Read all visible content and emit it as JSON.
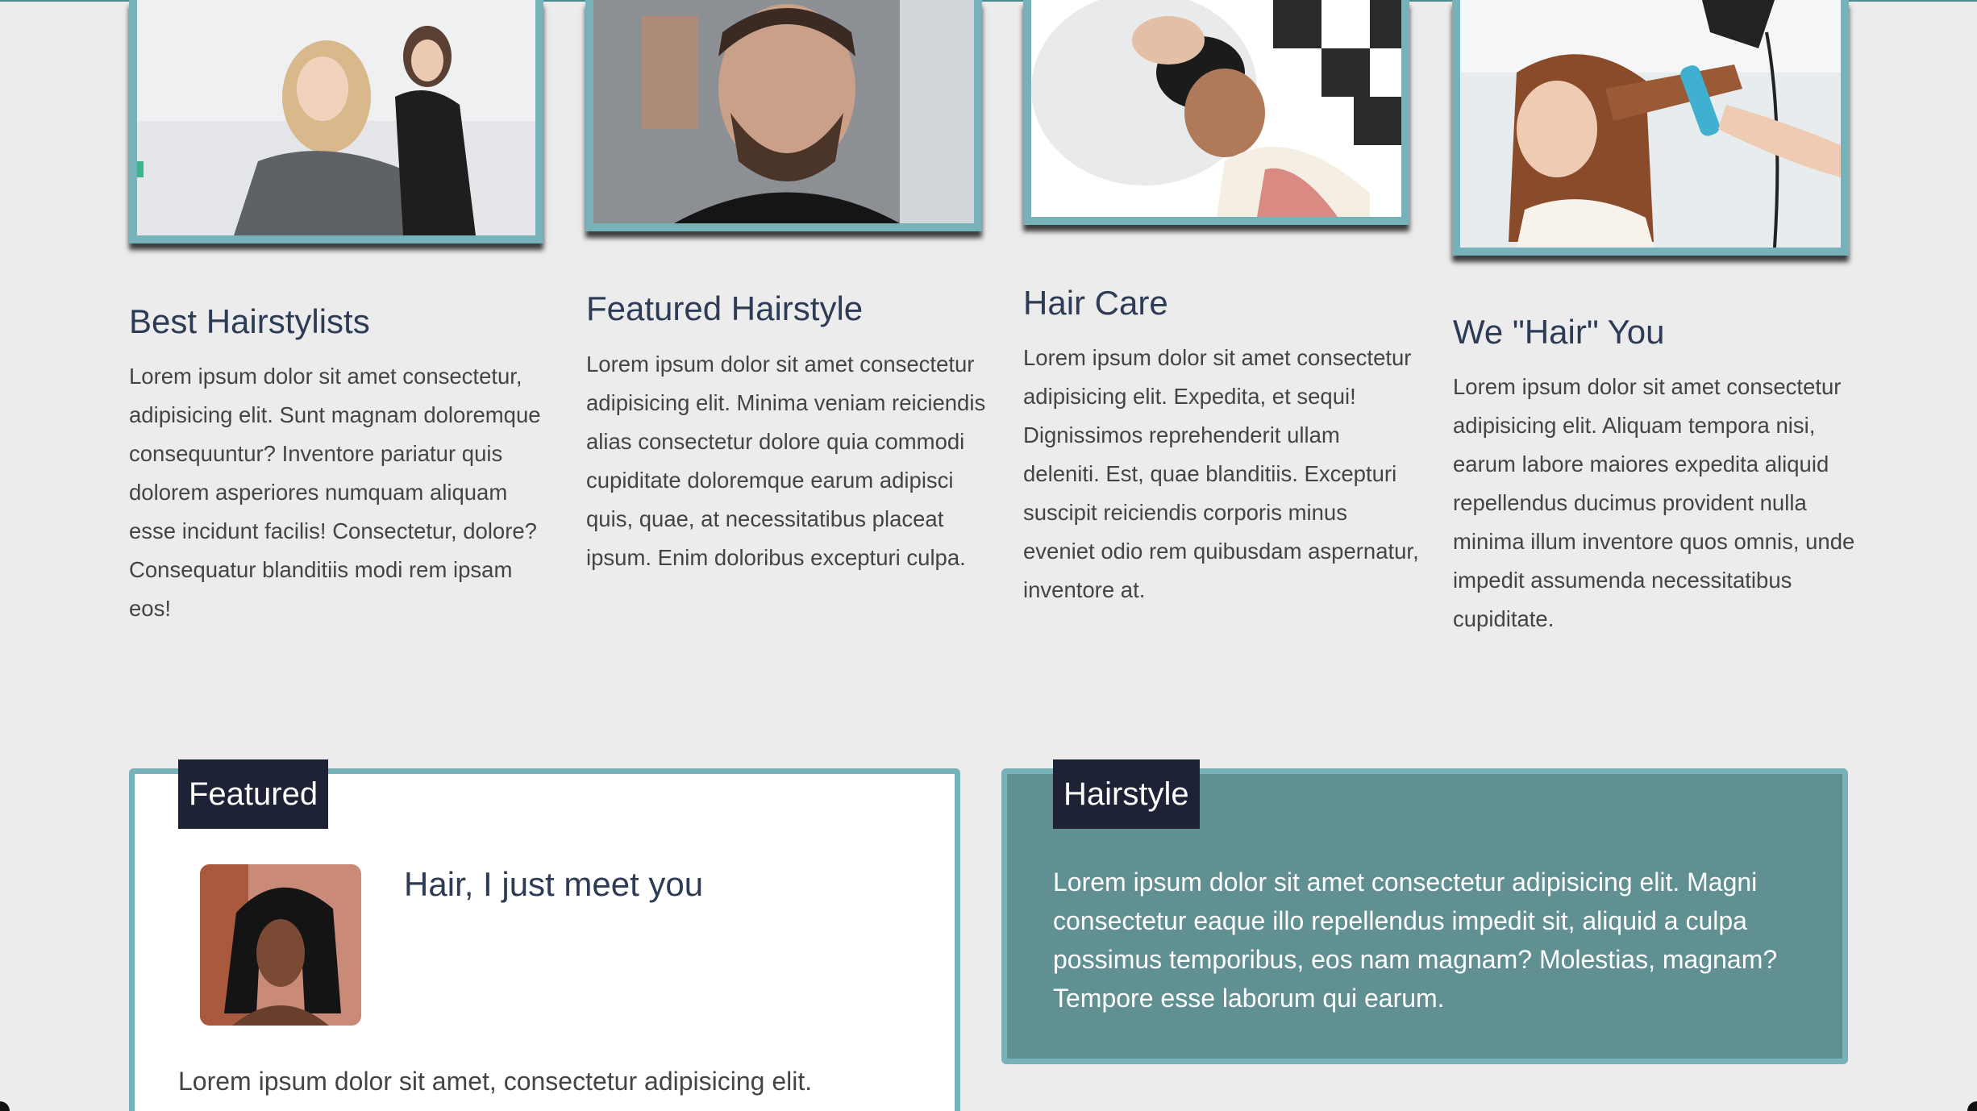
{
  "services": [
    {
      "title": "Best Hairstylists",
      "text": "Lorem ipsum dolor sit amet consectetur, adipisicing elit. Sunt magnam doloremque consequuntur? Inventore pariatur quis dolorem asperiores numquam aliquam esse incidunt facilis! Consectetur, dolore? Consequatur blanditiis modi rem ipsam eos!",
      "image": "salon-stylist-photo"
    },
    {
      "title": "Featured Hairstyle",
      "text": "Lorem ipsum dolor sit amet consectetur adipisicing elit. Minima veniam reiciendis alias consectetur dolore quia commodi cupiditate doloremque earum adipisci quis, quae, at necessitatibus placeat ipsum. Enim doloribus excepturi culpa.",
      "image": "barber-beard-photo"
    },
    {
      "title": "Hair Care",
      "text": "Lorem ipsum dolor sit amet consectetur adipisicing elit. Expedita, et sequi! Dignissimos reprehenderit ullam deleniti. Est, quae blanditiis. Excepturi suscipit reiciendis corporis minus eveniet odio rem quibusdam aspernatur, inventore at.",
      "image": "hair-wash-photo"
    },
    {
      "title": "We \"Hair\" You",
      "text": "Lorem ipsum dolor sit amet consectetur adipisicing elit. Aliquam tempora nisi, earum labore maiores expedita aliquid repellendus ducimus provident nulla minima illum inventore quos omnis, unde impedit assumenda necessitatibus cupiditate.",
      "image": "blow-dry-photo"
    }
  ],
  "featured": {
    "tag": "Featured",
    "heading": "Hair, I just meet you",
    "text": "Lorem ipsum dolor sit amet, consectetur adipisicing elit.",
    "image": "bob-haircut-portrait"
  },
  "hairstyle": {
    "tag": "Hairstyle",
    "text": "Lorem ipsum dolor sit amet consectetur adipisicing elit. Magni consectetur eaque illo repellendus impedit sit, aliquid a culpa possimus temporibus, eos nam magnam? Molestias, magnam? Tempore esse laborum qui earum."
  },
  "colors": {
    "background": "#ececec",
    "frame": "#77b1ba",
    "teal_box": "#619093",
    "tag": "#1e2236",
    "heading": "#2d3b55"
  }
}
